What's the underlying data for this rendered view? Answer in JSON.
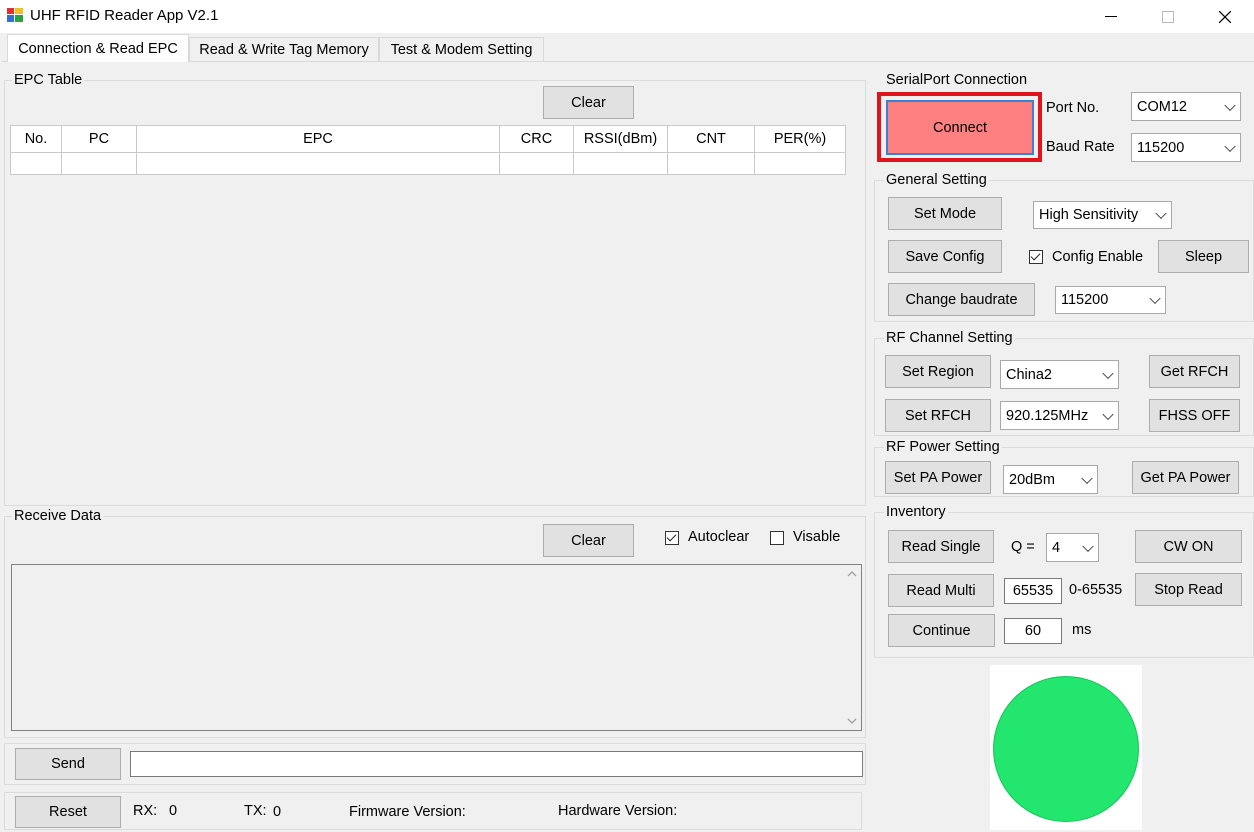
{
  "window": {
    "title": "UHF RFID Reader App V2.1",
    "minimize": "—",
    "maximize": "☐",
    "close": "✕"
  },
  "tabs": [
    {
      "label": "Connection & Read EPC"
    },
    {
      "label": "Read & Write Tag Memory"
    },
    {
      "label": "Test & Modem Setting"
    }
  ],
  "epc_table": {
    "group_label": "EPC Table",
    "clear_label": "Clear",
    "columns": [
      "No.",
      "PC",
      "EPC",
      "CRC",
      "RSSI(dBm)",
      "CNT",
      "PER(%)"
    ]
  },
  "receive": {
    "group_label": "Receive Data",
    "clear_label": "Clear",
    "autoclear_label": "Autoclear",
    "autoclear_checked": true,
    "visable_label": "Visable",
    "visable_checked": false
  },
  "send": {
    "button_label": "Send",
    "value": ""
  },
  "status": {
    "reset_label": "Reset",
    "rx_label": "RX:",
    "rx_value": "0",
    "tx_label": "TX:",
    "tx_value": "0",
    "firmware_label": "Firmware Version:",
    "hardware_label": "Hardware Version:"
  },
  "serial": {
    "group_label": "SerialPort Connection",
    "connect_label": "Connect",
    "connect_color": "#ff8080",
    "highlight_color": "#e0141e",
    "port_label": "Port No.",
    "port_value": "COM12",
    "baud_label": "Baud Rate",
    "baud_value": "115200"
  },
  "general": {
    "group_label": "General Setting",
    "set_mode_label": "Set Mode",
    "mode_value": "High Sensitivity",
    "save_config_label": "Save Config",
    "config_enable_label": "Config Enable",
    "config_enable_checked": true,
    "sleep_label": "Sleep",
    "change_baud_label": "Change baudrate",
    "baud_value": "115200"
  },
  "rf_channel": {
    "group_label": "RF Channel Setting",
    "set_region_label": "Set Region",
    "region_value": "China2",
    "get_rfch_label": "Get RFCH",
    "set_rfch_label": "Set RFCH",
    "freq_value": "920.125MHz",
    "fhss_label": "FHSS OFF"
  },
  "rf_power": {
    "group_label": "RF Power Setting",
    "set_pa_label": "Set PA Power",
    "power_value": "20dBm",
    "get_pa_label": "Get PA Power"
  },
  "inventory": {
    "group_label": "Inventory",
    "read_single_label": "Read Single",
    "q_label": "Q =",
    "q_value": "4",
    "cw_label": "CW ON",
    "read_multi_label": "Read Multi",
    "multi_value": "65535",
    "range_label": "0-65535",
    "stop_label": "Stop Read",
    "continue_label": "Continue",
    "interval_value": "60",
    "ms_label": "ms"
  },
  "indicator": {
    "color": "#22e66e",
    "state": "connected"
  }
}
